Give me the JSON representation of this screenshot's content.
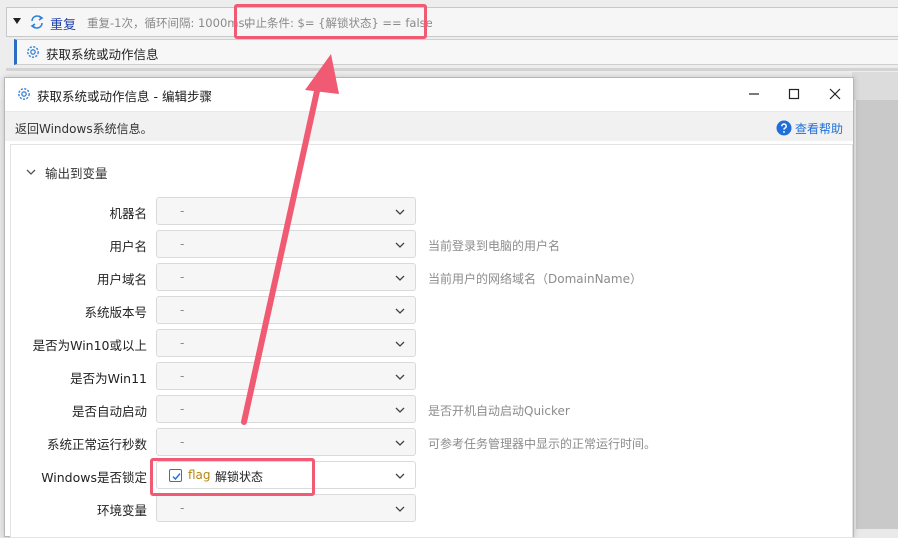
{
  "background_editor": {
    "repeat_title": "重复",
    "repeat_desc": "重复-1次，循环间隔: 1000ms，",
    "stop_condition": "中止条件: $= {解锁状态} == false",
    "child_step": "获取系统或动作信息"
  },
  "dialog": {
    "title": "获取系统或动作信息 - 编辑步骤",
    "description": "返回Windows系统信息。",
    "help_label": "查看帮助",
    "window_buttons": {
      "minimize": "minimize-icon",
      "maximize": "maximize-icon",
      "close": "close-icon"
    },
    "section_title": "输出到变量",
    "fields": [
      {
        "label": "机器名",
        "value": "-",
        "hint": ""
      },
      {
        "label": "用户名",
        "value": "-",
        "hint": "当前登录到电脑的用户名"
      },
      {
        "label": "用户域名",
        "value": "-",
        "hint": "当前用户的网络域名（DomainName）"
      },
      {
        "label": "系统版本号",
        "value": "-",
        "hint": ""
      },
      {
        "label": "是否为Win10或以上",
        "value": "-",
        "hint": ""
      },
      {
        "label": "是否为Win11",
        "value": "-",
        "hint": ""
      },
      {
        "label": "是否自动启动",
        "value": "-",
        "hint": "是否开机自动启动Quicker"
      },
      {
        "label": "系统正常运行秒数",
        "value": "-",
        "hint": "可参考任务管理器中显示的正常运行时间。"
      },
      {
        "label": "Windows是否锁定",
        "value": "",
        "hint": "",
        "checked": true,
        "var_type": "flag",
        "var_name": "解锁状态"
      },
      {
        "label": "环境变量",
        "value": "-",
        "hint": ""
      }
    ]
  },
  "colors": {
    "accent": "#1e6fd9",
    "annotation": "#f05a72",
    "flag_var": "#b8860b",
    "repeat_title": "#1f3ea8"
  }
}
